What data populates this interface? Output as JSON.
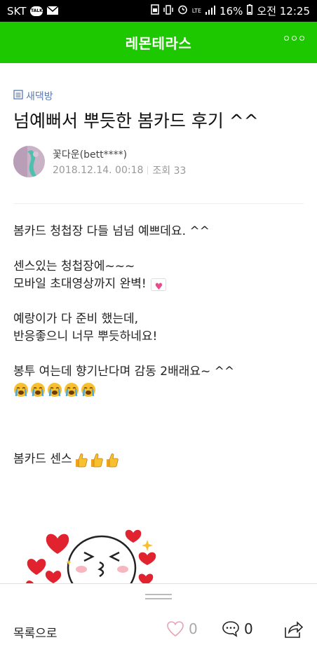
{
  "status_bar": {
    "carrier": "SKT",
    "talk_badge": "TALK",
    "network": "LTE",
    "battery": "16%",
    "time": "오전 12:25"
  },
  "app_bar": {
    "title": "레몬테라스",
    "more_icon": "more-dots-icon"
  },
  "post": {
    "board": "새댁방",
    "title": "넘예뻐서 뿌듯한 봄카드 후기 ^^",
    "author": "꽃다운(bett****)",
    "date": "2018.12.14. 00:18",
    "views": "조회 33",
    "body": {
      "line1": "봄카드 청첩장 다들 넘넘 예쁘데요. ^^",
      "line2": "센스있는 청첩장에~~~",
      "line3": "모바일 초대영상까지 완벽!",
      "line4": "예랑이가 다 준비 했는데,",
      "line5": "반응좋으니 너무 뿌듯하네요!",
      "line6": "봉투 여는데 향기난다며 감동 2배래요~ ^^",
      "line7": "봄카드 센스"
    }
  },
  "bottom_bar": {
    "back_label": "목록으로",
    "like_count": "0",
    "comment_count": "0"
  },
  "colors": {
    "brand": "#1ec800",
    "board_link": "#5b7ab3"
  }
}
